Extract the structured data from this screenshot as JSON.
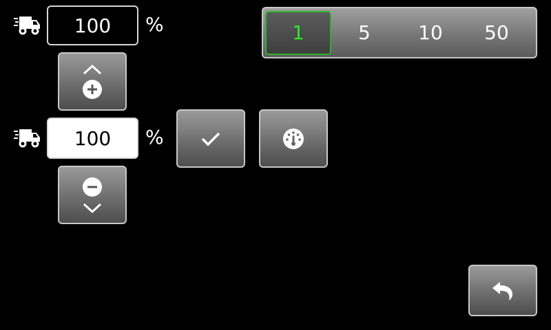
{
  "top_row": {
    "value": "100",
    "unit": "%"
  },
  "bottom_row": {
    "value": "100",
    "unit": "%"
  },
  "step_selector": {
    "options": [
      "1",
      "5",
      "10",
      "50"
    ],
    "selected": "1"
  },
  "icons": {
    "truck": "truck-icon",
    "increase": "chevron-up-plus-icon",
    "decrease": "minus-chevron-down-icon",
    "confirm": "checkmark-icon",
    "gauge": "speedometer-icon",
    "back": "undo-arrow-icon"
  },
  "colors": {
    "selected_text": "#2ee62e",
    "selected_border": "#2fb52f",
    "background": "#000000"
  }
}
